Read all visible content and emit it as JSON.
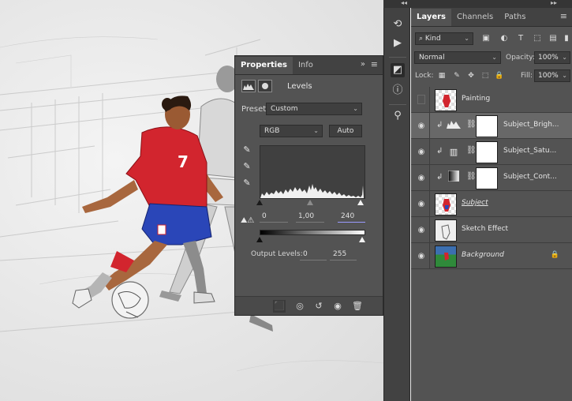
{
  "properties_panel": {
    "tabs": [
      {
        "label": "Properties",
        "active": true
      },
      {
        "label": "Info",
        "active": false
      }
    ],
    "collapse_glyph": "»",
    "menu_glyph": "≡",
    "header_title": "Levels",
    "preset_label": "Preset:",
    "preset_value": "Custom",
    "channel_value": "RGB",
    "auto_label": "Auto",
    "input_levels": {
      "black": "0",
      "gamma": "1,00",
      "white": "240"
    },
    "output_levels_label": "Output Levels:",
    "output_levels": {
      "black": "0",
      "white": "255"
    }
  },
  "layers_panel": {
    "tabs": [
      {
        "label": "Layers",
        "active": true
      },
      {
        "label": "Channels",
        "active": false
      },
      {
        "label": "Paths",
        "active": false
      }
    ],
    "filter_value": "Kind",
    "blend_mode": "Normal",
    "opacity_label": "Opacity:",
    "opacity_value": "100%",
    "lock_label": "Lock:",
    "fill_label": "Fill:",
    "fill_value": "100%",
    "layers": [
      {
        "name": "Painting",
        "visible": false,
        "type": "pixel"
      },
      {
        "name": "Subject_Brigh...",
        "visible": true,
        "type": "adjustment",
        "icon": "levels-icon",
        "selected": true
      },
      {
        "name": "Subject_Satu...",
        "visible": true,
        "type": "adjustment",
        "icon": "hue-saturation-icon"
      },
      {
        "name": "Subject_Cont...",
        "visible": true,
        "type": "adjustment",
        "icon": "gradient-map-icon"
      },
      {
        "name": "Subject",
        "visible": true,
        "type": "pixel"
      },
      {
        "name": "Sketch Effect",
        "visible": true,
        "type": "pixel"
      },
      {
        "name": "Background",
        "visible": true,
        "type": "pixel",
        "locked": true
      }
    ]
  },
  "colors": {
    "panel_bg": "#535353",
    "tab_bg": "#424242",
    "jersey_red": "#d2252e",
    "shorts_blue": "#2a46b8"
  }
}
